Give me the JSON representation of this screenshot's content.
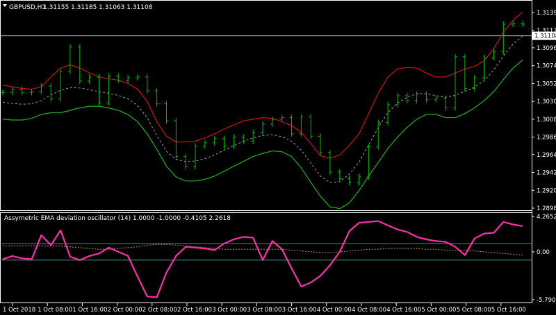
{
  "window": {
    "menu_icon": "triangle-down-icon",
    "symbol": "GBPUSD,H1",
    "ohlc": "1.31155 1.31185 1.31063 1.31108"
  },
  "indicator": {
    "title": "Assymetric EMA deviation oscillator (14) 1.0000 -1.0000 -0.4105 2.2618"
  },
  "price_axis": {
    "labels": [
      "1.31395",
      "1.31175",
      "1.30960",
      "1.30740",
      "1.30520",
      "1.30300",
      "1.30080",
      "1.29860",
      "1.29645",
      "1.29425",
      "1.29205",
      "1.28985"
    ],
    "current_price": "1.31108"
  },
  "osc_axis": {
    "labels": [
      "4.2652",
      "0.00",
      "-5.7903"
    ]
  },
  "time_axis": {
    "labels": [
      "1 Oct 2018",
      "1 Oct 08:00",
      "1 Oct 16:00",
      "2 Oct 00:00",
      "2 Oct 08:00",
      "2 Oct 16:00",
      "3 Oct 00:00",
      "3 Oct 08:00",
      "3 Oct 16:00",
      "4 Oct 00:00",
      "4 Oct 08:00",
      "4 Oct 16:00",
      "5 Oct 00:00",
      "5 Oct 08:00",
      "5 Oct 16:00"
    ]
  },
  "colors": {
    "background": "#000000",
    "bars": "#00c000",
    "upper_band": "#d01010",
    "lower_band": "#20b020",
    "middle_line": "#a0a0a0",
    "oscillator": "#ff2fa8",
    "osc_signal": "#c89040",
    "levels": "#4a8a8a",
    "grid": "#ffffff"
  },
  "chart_data": [
    {
      "type": "line",
      "series": [
        {
          "values": [
            1.3041,
            1.3045,
            1.3041,
            1.3042,
            1.3049,
            1.3033,
            1.3067,
            1.3097,
            1.3055,
            1.306,
            1.3028,
            1.3061,
            1.3056,
            1.3059,
            1.306,
            1.3043,
            1.3027,
            1.3006,
            1.2962,
            1.295,
            1.2975,
            1.2979,
            1.2984,
            1.2975,
            1.2986,
            1.2981,
            1.2992,
            1.3002,
            1.3008,
            1.301,
            1.299,
            1.3011,
            1.2987,
            1.2967,
            1.2943,
            1.2935,
            1.293,
            1.2937,
            1.2974,
            1.3004,
            1.3026,
            1.3037,
            1.3031,
            1.3039,
            1.3032,
            1.3034,
            1.3022,
            1.3085,
            1.3046,
            1.3059,
            1.3084,
            1.3091,
            1.3125,
            1.3126,
            1.3125
          ]
        },
        {
          "values": [
            1.305,
            1.3048,
            1.3046,
            1.3045,
            1.3048,
            1.306,
            1.3071,
            1.3075,
            1.3071,
            1.3065,
            1.306,
            1.3058,
            1.3056,
            1.3052,
            1.3045,
            1.303,
            1.3005,
            1.2987,
            1.298,
            1.298,
            1.2981,
            1.2985,
            1.299,
            1.2996,
            1.3001,
            1.3006,
            1.3008,
            1.301,
            1.3009,
            1.3005,
            1.3,
            1.2992,
            1.2978,
            1.2963,
            1.296,
            1.2964,
            1.2976,
            1.299,
            1.3015,
            1.304,
            1.306,
            1.307,
            1.3072,
            1.3071,
            1.3065,
            1.306,
            1.306,
            1.3065,
            1.307,
            1.3073,
            1.308,
            1.3095,
            1.3115,
            1.313,
            1.314
          ]
        },
        {
          "values": [
            1.3008,
            1.3007,
            1.3007,
            1.3009,
            1.3014,
            1.3016,
            1.3016,
            1.3019,
            1.3022,
            1.3024,
            1.3024,
            1.3022,
            1.3019,
            1.3014,
            1.3005,
            1.299,
            1.2971,
            1.295,
            1.2937,
            1.2932,
            1.2932,
            1.2934,
            1.2938,
            1.2944,
            1.295,
            1.2956,
            1.2962,
            1.2966,
            1.2969,
            1.2968,
            1.2962,
            1.2948,
            1.293,
            1.2913,
            1.29,
            1.2898,
            1.2905,
            1.292,
            1.2938,
            1.2955,
            1.2972,
            1.2986,
            1.2998,
            1.3008,
            1.3014,
            1.3014,
            1.301,
            1.301,
            1.3015,
            1.3022,
            1.3031,
            1.3042,
            1.3057,
            1.3071,
            1.3081
          ]
        }
      ]
    },
    {
      "type": "line",
      "series": [
        {
          "values": [
            -0.9,
            -0.5,
            -0.8,
            -0.9,
            2.0,
            0.8,
            2.6,
            -0.6,
            -1.0,
            -0.5,
            -0.2,
            0.5,
            0.0,
            -0.5,
            -3.0,
            -5.4,
            -5.5,
            -2.5,
            -0.5,
            0.6,
            0.5,
            0.4,
            0.2,
            1.0,
            1.5,
            1.8,
            1.7,
            -1.0,
            1.3,
            0.3,
            -2.0,
            -4.2,
            -3.7,
            -2.9,
            -1.6,
            0.0,
            2.5,
            3.5,
            3.6,
            3.7,
            3.2,
            2.7,
            2.4,
            1.8,
            1.5,
            1.3,
            1.2,
            0.6,
            -0.4,
            1.6,
            2.2,
            2.3,
            3.6,
            3.3,
            3.1
          ]
        },
        {
          "values": [
            0.7,
            0.7,
            0.7,
            0.7,
            0.7,
            0.7,
            0.7,
            0.6,
            0.5,
            0.4,
            0.3,
            0.3,
            0.4,
            0.5,
            0.6,
            0.8,
            0.9,
            0.9,
            0.8,
            0.7,
            0.6,
            0.5,
            0.4,
            0.3,
            0.3,
            0.3,
            0.3,
            0.3,
            0.3,
            0.3,
            0.2,
            0.1,
            0.0,
            -0.1,
            -0.1,
            0.0,
            0.1,
            0.2,
            0.3,
            0.3,
            0.4,
            0.4,
            0.4,
            0.4,
            0.3,
            0.3,
            0.2,
            0.2,
            0.2,
            0.1,
            0.0,
            -0.1,
            -0.2,
            -0.3,
            -0.4
          ]
        }
      ]
    }
  ]
}
